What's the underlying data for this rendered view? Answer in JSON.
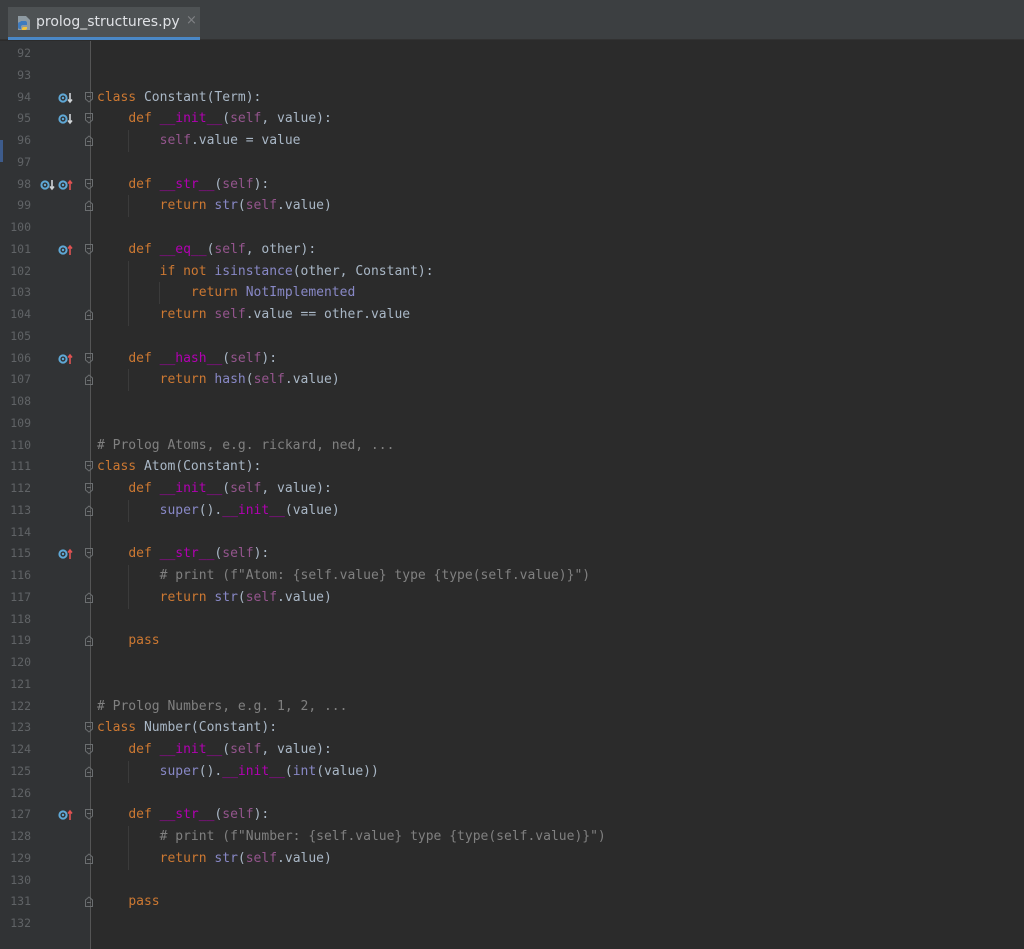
{
  "tab": {
    "filename": "prolog_structures.py",
    "close_icon": "×"
  },
  "lines": [
    {
      "n": "92",
      "code": ""
    },
    {
      "n": "93",
      "code": ""
    },
    {
      "n": "94",
      "code": "class Constant(Term):"
    },
    {
      "n": "95",
      "code": "    def __init__(self, value):"
    },
    {
      "n": "96",
      "code": "        self.value = value"
    },
    {
      "n": "97",
      "code": ""
    },
    {
      "n": "98",
      "code": "    def __str__(self):"
    },
    {
      "n": "99",
      "code": "        return str(self.value)"
    },
    {
      "n": "100",
      "code": ""
    },
    {
      "n": "101",
      "code": "    def __eq__(self, other):"
    },
    {
      "n": "102",
      "code": "        if not isinstance(other, Constant):"
    },
    {
      "n": "103",
      "code": "            return NotImplemented"
    },
    {
      "n": "104",
      "code": "        return self.value == other.value"
    },
    {
      "n": "105",
      "code": ""
    },
    {
      "n": "106",
      "code": "    def __hash__(self):"
    },
    {
      "n": "107",
      "code": "        return hash(self.value)"
    },
    {
      "n": "108",
      "code": ""
    },
    {
      "n": "109",
      "code": ""
    },
    {
      "n": "110",
      "code": "# Prolog Atoms, e.g. rickard, ned, ..."
    },
    {
      "n": "111",
      "code": "class Atom(Constant):"
    },
    {
      "n": "112",
      "code": "    def __init__(self, value):"
    },
    {
      "n": "113",
      "code": "        super().__init__(value)"
    },
    {
      "n": "114",
      "code": ""
    },
    {
      "n": "115",
      "code": "    def __str__(self):"
    },
    {
      "n": "116",
      "code": "        # print (f\"Atom: {self.value} type {type(self.value)}\")"
    },
    {
      "n": "117",
      "code": "        return str(self.value)"
    },
    {
      "n": "118",
      "code": ""
    },
    {
      "n": "119",
      "code": "    pass"
    },
    {
      "n": "120",
      "code": ""
    },
    {
      "n": "121",
      "code": ""
    },
    {
      "n": "122",
      "code": "# Prolog Numbers, e.g. 1, 2, ..."
    },
    {
      "n": "123",
      "code": "class Number(Constant):"
    },
    {
      "n": "124",
      "code": "    def __init__(self, value):"
    },
    {
      "n": "125",
      "code": "        super().__init__(int(value))"
    },
    {
      "n": "126",
      "code": ""
    },
    {
      "n": "127",
      "code": "    def __str__(self):"
    },
    {
      "n": "128",
      "code": "        # print (f\"Number: {self.value} type {type(self.value)}\")"
    },
    {
      "n": "129",
      "code": "        return str(self.value)"
    },
    {
      "n": "130",
      "code": ""
    },
    {
      "n": "131",
      "code": "    pass"
    },
    {
      "n": "132",
      "code": ""
    }
  ],
  "gutter_icons": [
    {
      "line": "94",
      "icons": [
        "implemented-down-icon"
      ]
    },
    {
      "line": "95",
      "icons": [
        "implemented-down-icon"
      ]
    },
    {
      "line": "98",
      "icons": [
        "implemented-down-icon",
        "overrides-up-icon"
      ]
    },
    {
      "line": "101",
      "icons": [
        "overrides-up-icon"
      ]
    },
    {
      "line": "106",
      "icons": [
        "overrides-up-icon"
      ]
    },
    {
      "line": "115",
      "icons": [
        "overrides-up-icon"
      ]
    },
    {
      "line": "127",
      "icons": [
        "overrides-up-icon"
      ]
    }
  ],
  "colors": {
    "background": "#2b2b2b",
    "keyword": "#cc7832",
    "dunder": "#b200b2",
    "self": "#94558d",
    "builtin": "#8888c6",
    "comment": "#808080",
    "text": "#a9b7c6",
    "accent": "#4a88c7"
  }
}
